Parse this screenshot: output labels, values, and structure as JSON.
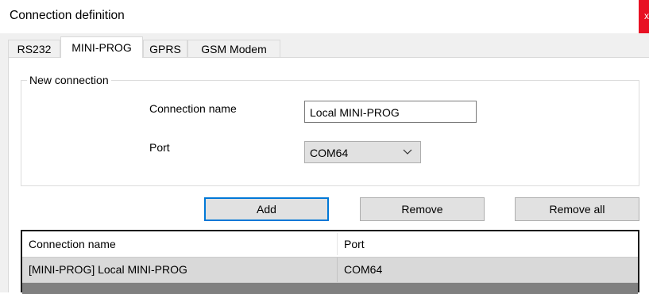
{
  "window": {
    "title": "Connection definition",
    "close_glyph": "x"
  },
  "tabs": [
    {
      "label": "RS232",
      "active": false
    },
    {
      "label": "MINI-PROG",
      "active": true
    },
    {
      "label": "GPRS",
      "active": false
    },
    {
      "label": "GSM Modem",
      "active": false
    }
  ],
  "new_connection": {
    "legend": "New connection",
    "name_label": "Connection name",
    "name_value": "Local MINI-PROG",
    "port_label": "Port",
    "port_value": "COM64"
  },
  "buttons": {
    "add": "Add",
    "remove": "Remove",
    "remove_all": "Remove all"
  },
  "list": {
    "columns": [
      "Connection name",
      "Port"
    ],
    "rows": [
      {
        "name": "[MINI-PROG] Local MINI-PROG",
        "port": "COM64",
        "selected": true
      }
    ]
  },
  "colors": {
    "accent": "#0078d7",
    "close": "#e81123",
    "selection": "#d9d9d9"
  }
}
